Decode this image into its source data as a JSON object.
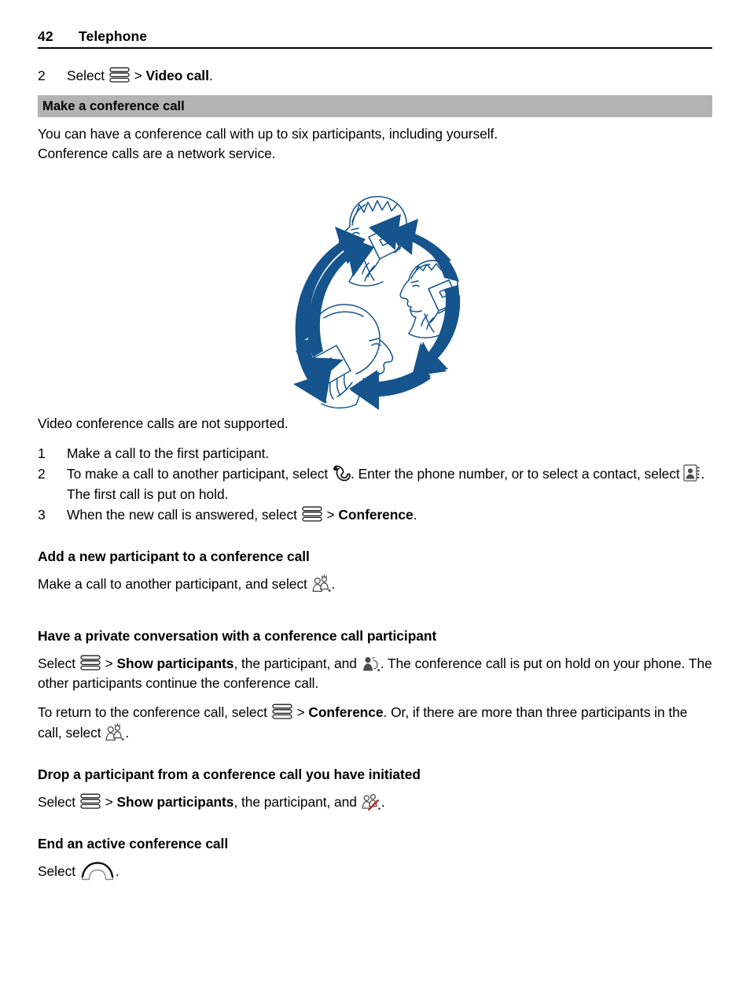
{
  "header": {
    "page_number": "42",
    "chapter": "Telephone"
  },
  "steps_video_call": [
    {
      "num": "2",
      "pre": "Select ",
      "icon": "menu-icon",
      "post": " > ",
      "bold": "Video call",
      "tail": "."
    }
  ],
  "section_make_conference": {
    "heading": "Make a conference call",
    "intro_line1": "You can have a conference call with up to six participants, including yourself.",
    "intro_line2": "Conference calls are a network service.",
    "figure_alt": "Three people talking on mobile phones connected by circular arrows",
    "note": "Video conference calls are not supported.",
    "steps": [
      {
        "num": "1",
        "text": "Make a call to the first participant."
      },
      {
        "num": "2",
        "part1": "To make a call to another participant, select ",
        "icon1": "call-handset-icon",
        "part2": ". Enter the phone number, or to select a contact, select ",
        "icon2": "contact-card-icon",
        "part3": ". The first call is put on hold."
      },
      {
        "num": "3",
        "part1": "When the new call is answered, select ",
        "icon1": "menu-icon",
        "part2": " > ",
        "bold": "Conference",
        "part3": "."
      }
    ]
  },
  "section_add_participant": {
    "heading": "Add a new participant to a conference call",
    "part1": "Make a call to another participant, and select ",
    "icon1": "add-participant-icon",
    "part2": "."
  },
  "section_private_conversation": {
    "heading": "Have a private conversation with a conference call participant",
    "para1_part1": "Select ",
    "para1_icon1": "menu-icon",
    "para1_part2": " > ",
    "para1_bold1": "Show participants",
    "para1_part3": ", the participant, and ",
    "para1_icon2": "private-call-icon",
    "para1_part4": ". The conference call is put on hold on your phone. The other participants continue the conference call.",
    "para2_part1": "To return to the conference call, select ",
    "para2_icon1": "menu-icon",
    "para2_part2": " > ",
    "para2_bold1": "Conference",
    "para2_part3": ". Or, if there are more than three participants in the call, select ",
    "para2_icon2": "add-participant-icon",
    "para2_part4": "."
  },
  "section_drop_participant": {
    "heading": "Drop a participant from a conference call you have initiated",
    "part1": "Select ",
    "icon1": "menu-icon",
    "part2": " > ",
    "bold1": "Show participants",
    "part3": ", the participant, and ",
    "icon2": "drop-participant-icon",
    "part4": "."
  },
  "section_end_call": {
    "heading": "End an active conference call",
    "part1": "Select ",
    "icon1": "end-call-icon",
    "part2": "."
  },
  "colors": {
    "illustration_blue": "#15548c",
    "heading_bar_gray": "#b3b3b3",
    "drop_slash_red": "#b8352c",
    "text_black": "#000000"
  }
}
